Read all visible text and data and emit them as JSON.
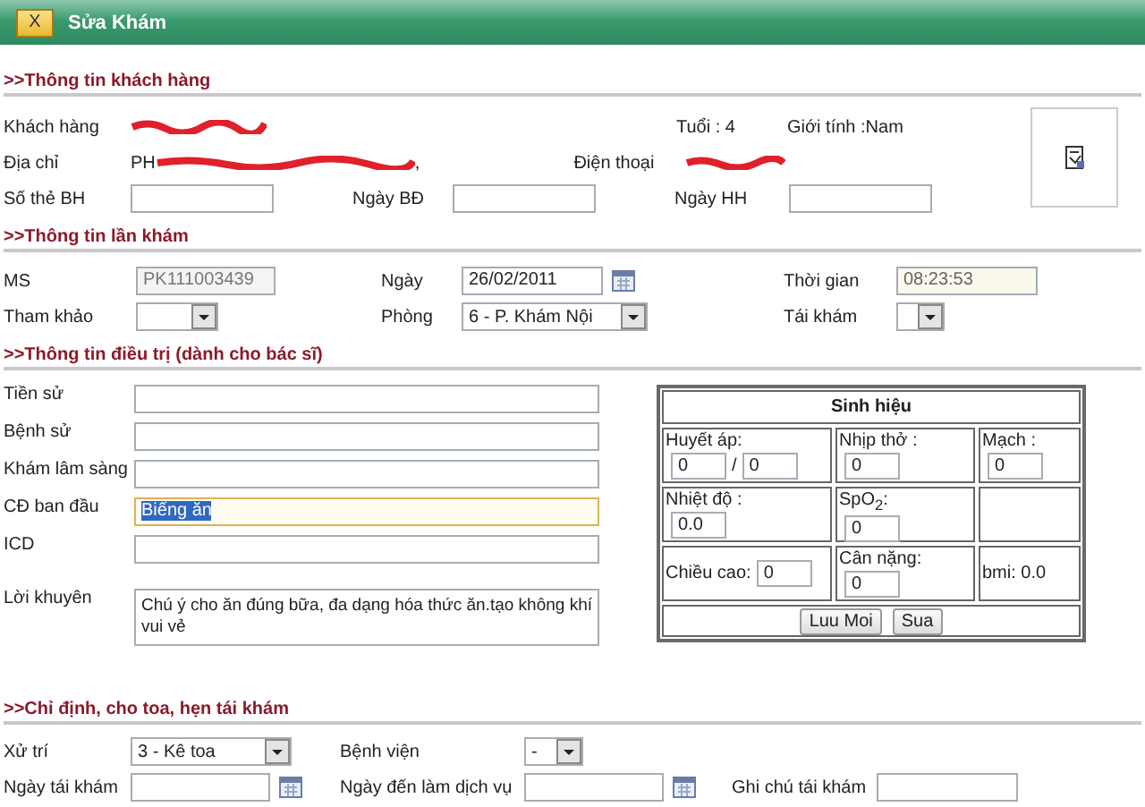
{
  "window": {
    "title": "Sửa Khám",
    "close_button": "X"
  },
  "customer": {
    "heading": ">>Thông tin khách hàng",
    "name_label": "Khách hàng",
    "age": "Tuổi : 4",
    "gender": "Giới tính :Nam",
    "address_label": "Địa chỉ",
    "address_start": "PH",
    "address_end": ",",
    "phone_label": "Điện thoại",
    "insurance_label": "Số thẻ BH",
    "start_label": "Ngày BĐ",
    "end_label": "Ngày HH"
  },
  "visit": {
    "heading": ">>Thông tin lần khám",
    "ms_label": "MS",
    "ms_value": "PK111003439",
    "date_label": "Ngày",
    "date_value": "26/02/2011",
    "time_label": "Thời gian",
    "time_value": "08:23:53",
    "ref_label": "Tham khảo",
    "room_label": "Phòng",
    "room_value": "6 - P. Khám Nội",
    "revisit_label": "Tái khám"
  },
  "treatment": {
    "heading": ">>Thông tin điều trị (dành cho bác sĩ)",
    "fields": [
      {
        "label": "Tiền sử",
        "focused": false
      },
      {
        "label": "Bệnh sử",
        "focused": false
      },
      {
        "label": "Khám lâm sàng",
        "focused": false
      },
      {
        "label": "CĐ ban đầu",
        "value": "Biếng ăn",
        "focused": true
      },
      {
        "label": "ICD",
        "focused": false
      },
      {
        "label": "Lời khuyên",
        "value": "Chú ý cho ăn đúng bữa, đa dạng hóa thức ăn.tạo không khí vui vẻ",
        "focused": false
      }
    ],
    "vitals": {
      "title": "Sinh hiệu",
      "rows": [
        [
          {
            "kind": "inputs",
            "label": "Huyết áp:",
            "values": [
              "0",
              "0"
            ],
            "separator": "/"
          },
          {
            "kind": "inputs",
            "label": "Nhịp thở :",
            "values": [
              "0"
            ]
          },
          {
            "kind": "inputs",
            "label": "Mạch :",
            "values": [
              "0"
            ]
          }
        ],
        [
          {
            "kind": "inputs",
            "label": "Nhiệt độ :",
            "values": [
              "0.0"
            ]
          },
          {
            "kind": "inputs",
            "label": "SpO$_{2}$:",
            "values": [
              "0"
            ]
          },
          {
            "kind": "empty"
          }
        ],
        [
          {
            "kind": "inline",
            "label": "Chiều cao:",
            "values": [
              "0"
            ]
          },
          {
            "kind": "inputs",
            "label": "Cân nặng:",
            "values": [
              "0"
            ]
          },
          {
            "kind": "text",
            "label": "bmi: 0.0"
          }
        ]
      ],
      "buttons": [
        "Luu Moi",
        "Sua"
      ]
    }
  },
  "orders": {
    "heading": ">>Chỉ định, cho toa, hẹn tái khám",
    "action_label": "Xử trí",
    "action_value": "3 - Kê toa",
    "hospital_label": "Bệnh viện",
    "hospital_value": "-",
    "revisit_date_label": "Ngày tái khám",
    "service_date_label": "Ngày đến làm dịch vụ",
    "note_label": "Ghi chú tái khám"
  }
}
